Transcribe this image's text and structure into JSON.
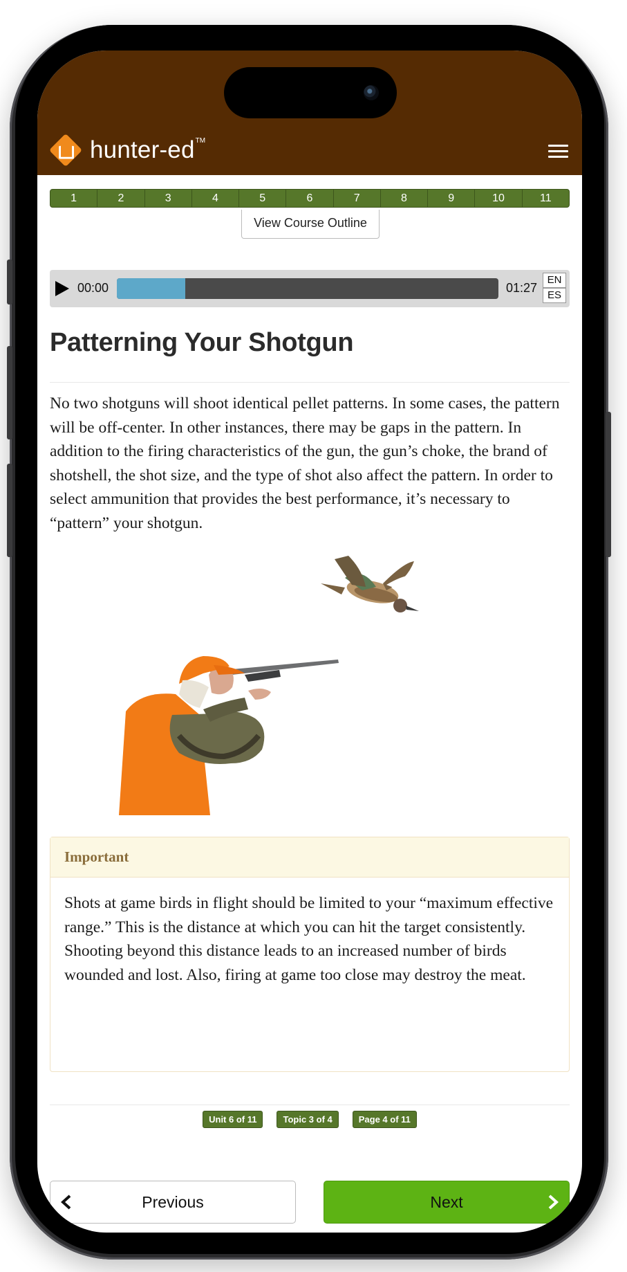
{
  "app": {
    "logo_text": "hunter-ed",
    "logo_tm": "TM"
  },
  "course_nav": {
    "units": [
      "1",
      "2",
      "3",
      "4",
      "5",
      "6",
      "7",
      "8",
      "9",
      "10",
      "11"
    ],
    "outline_label": "View Course Outline"
  },
  "audio": {
    "current_time": "00:00",
    "duration": "01:27",
    "progress": 0.18,
    "lang_en": "EN",
    "lang_es": "ES"
  },
  "page": {
    "title": "Patterning Your Shotgun",
    "body": "No two shotguns will shoot identical pellet patterns. In some cases, the pattern will be off-center. In other instances, there may be gaps in the pattern. In addition to the firing characteristics of the gun, the gun’s choke, the brand of shotshell, the shot size, and the type of shot also affect the pattern. In order to select ammunition that provides the best performance, it’s necessary to “pattern” your shotgun."
  },
  "callout": {
    "heading": "Important",
    "text": "Shots at game birds in flight should be limited to your “maximum effective range.” This is the distance at which you can hit the target consistently. Shooting beyond this distance leads to an increased number of birds wounded and lost. Also, firing at game too close may destroy the meat."
  },
  "location": {
    "unit": "Unit 6 of 11",
    "topic": "Topic 3 of 4",
    "page": "Page 4 of 11"
  },
  "buttons": {
    "previous": "Previous",
    "next": "Next"
  },
  "colors": {
    "header_bg": "#552b03",
    "unit_bar": "#56772a",
    "audio_fill": "#5da8c9",
    "next_bg": "#5db314",
    "callout_head_bg": "#fcf8e3",
    "callout_head_text": "#8a6d3b"
  },
  "icons": [
    "hunter-ed-logo-icon",
    "menu-icon",
    "play-icon",
    "chevron-left-icon",
    "chevron-right-icon"
  ]
}
